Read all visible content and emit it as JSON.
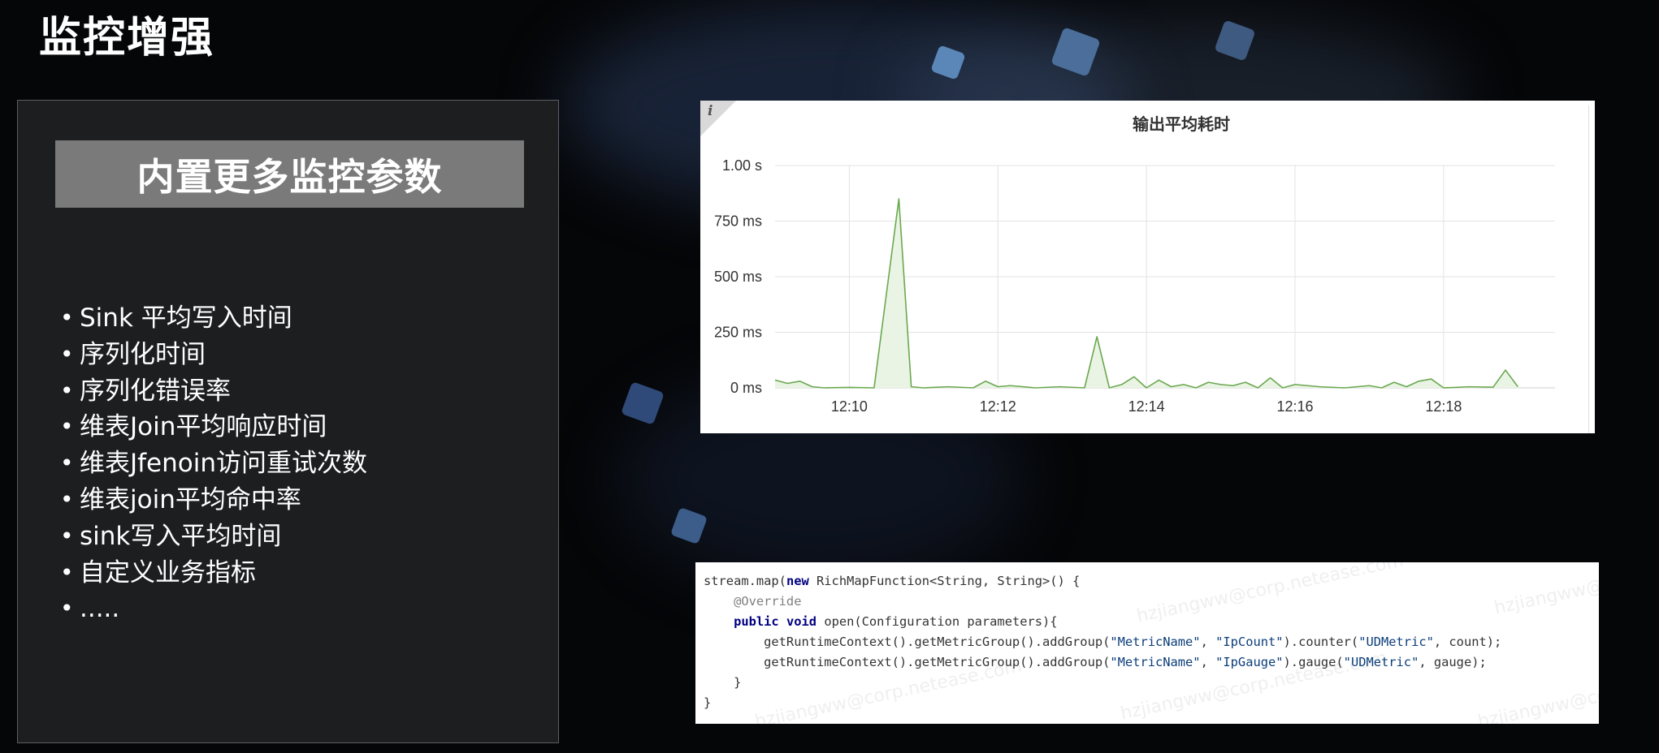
{
  "slide": {
    "title": "监控增强",
    "panel_header": "内置更多监控参数",
    "bullets": [
      "Sink 平均写入时间",
      "序列化时间",
      "序列化错误率",
      "维表Join平均响应时间",
      "维表Jfenoin访问重试次数",
      "维表join平均命中率",
      "sink写入平均时间",
      "自定义业务指标",
      "....."
    ]
  },
  "chart_panel": {
    "info_icon": "i"
  },
  "chart_data": {
    "type": "line",
    "title": "输出平均耗时",
    "xlabel": "",
    "ylabel": "",
    "x_ticks": [
      "12:10",
      "12:12",
      "12:14",
      "12:16",
      "12:18"
    ],
    "y_ticks": [
      "0 ms",
      "250 ms",
      "500 ms",
      "750 ms",
      "1.00 s"
    ],
    "ylim": [
      0,
      1000
    ],
    "xlim": [
      "12:09:00",
      "12:19:30"
    ],
    "grid": true,
    "line_color": "#6aa84f",
    "fill_color": "#eaf4e4",
    "series": [
      {
        "x": [
          "12:09:00",
          "12:09:10",
          "12:09:20",
          "12:09:30",
          "12:09:40",
          "12:10:00",
          "12:10:20",
          "12:10:40",
          "12:10:50",
          "12:11:00",
          "12:11:20",
          "12:11:40",
          "12:11:50",
          "12:12:00",
          "12:12:10",
          "12:12:30",
          "12:12:50",
          "12:13:10",
          "12:13:20",
          "12:13:30",
          "12:13:40",
          "12:13:50",
          "12:14:00",
          "12:14:10",
          "12:14:20",
          "12:14:30",
          "12:14:40",
          "12:14:50",
          "12:15:00",
          "12:15:10",
          "12:15:20",
          "12:15:30",
          "12:15:40",
          "12:15:50",
          "12:16:00",
          "12:16:20",
          "12:16:40",
          "12:17:00",
          "12:17:10",
          "12:17:20",
          "12:17:30",
          "12:17:40",
          "12:17:50",
          "12:18:00",
          "12:18:10",
          "12:18:20",
          "12:18:40",
          "12:18:50",
          "12:19:00"
        ],
        "values": [
          35,
          20,
          30,
          5,
          0,
          2,
          0,
          850,
          5,
          0,
          5,
          0,
          30,
          5,
          10,
          0,
          5,
          0,
          230,
          0,
          15,
          50,
          0,
          35,
          5,
          15,
          0,
          25,
          15,
          10,
          25,
          0,
          45,
          0,
          15,
          5,
          0,
          10,
          0,
          25,
          5,
          30,
          40,
          0,
          2,
          5,
          3,
          80,
          5
        ]
      }
    ]
  },
  "code": {
    "line1_prefix": "stream.map(",
    "line1_kw": "new",
    "line1_rest": " RichMapFunction<String, String>() {",
    "line2": "    @Override",
    "line3_kw1": "public",
    "line3_kw2": "void",
    "line3_rest": " open(Configuration parameters){",
    "line4_a": "        getRuntimeContext().getMetricGroup().addGroup(",
    "line4_s1": "\"MetricName\"",
    "line4_b": ", ",
    "line4_s2": "\"IpCount\"",
    "line4_c": ").counter(",
    "line4_s3": "\"UDMetric\"",
    "line4_d": ", count);",
    "line5_a": "        getRuntimeContext().getMetricGroup().addGroup(",
    "line5_s1": "\"MetricName\"",
    "line5_b": ", ",
    "line5_s2": "\"IpGauge\"",
    "line5_c": ").gauge(",
    "line5_s3": "\"UDMetric\"",
    "line5_d": ", gauge);",
    "line6": "    }",
    "line7": "}"
  },
  "watermark": "hzjiangww@corp.netease.com"
}
